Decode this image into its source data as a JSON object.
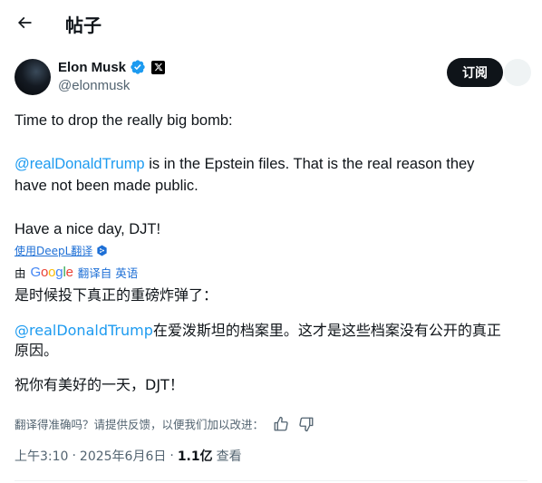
{
  "header": {
    "title": "帖子"
  },
  "author": {
    "display_name": "Elon Musk",
    "handle": "@elonmusk",
    "subscribe_label": "订阅",
    "verified_color": "#1d9bf0"
  },
  "tweet": {
    "line1": "Time to drop the really big bomb:",
    "mention": "@realDonaldTrump",
    "line2_rest": " is in the Epstein files. That is the real reason they",
    "line3": "have not been made public.",
    "line4": "Have a nice day, DJT!"
  },
  "translation": {
    "deepl_label": "使用DeepL翻译",
    "by_prefix": "由",
    "google_logo": "Google",
    "translated_from": "翻译自 英语",
    "cn_line1": "是时候投下真正的重磅炸弹了：",
    "cn_mention": "@realDonaldTrump",
    "cn_line2_rest": "在爱泼斯坦的档案里。这才是这些档案没有公开的真正",
    "cn_line3": "原因。",
    "cn_line4": "祝你有美好的一天，DJT！",
    "feedback_question": "翻译得准确吗？请提供反馈，以便我们加以改进："
  },
  "meta": {
    "time": "上午3:10",
    "sep1": "·",
    "date": "2025年6月6日",
    "sep2": "·",
    "views_count": "1.1亿",
    "views_label": "查看"
  },
  "colors": {
    "link": "#1d9bf0",
    "text": "#0f1419",
    "muted": "#536471"
  }
}
